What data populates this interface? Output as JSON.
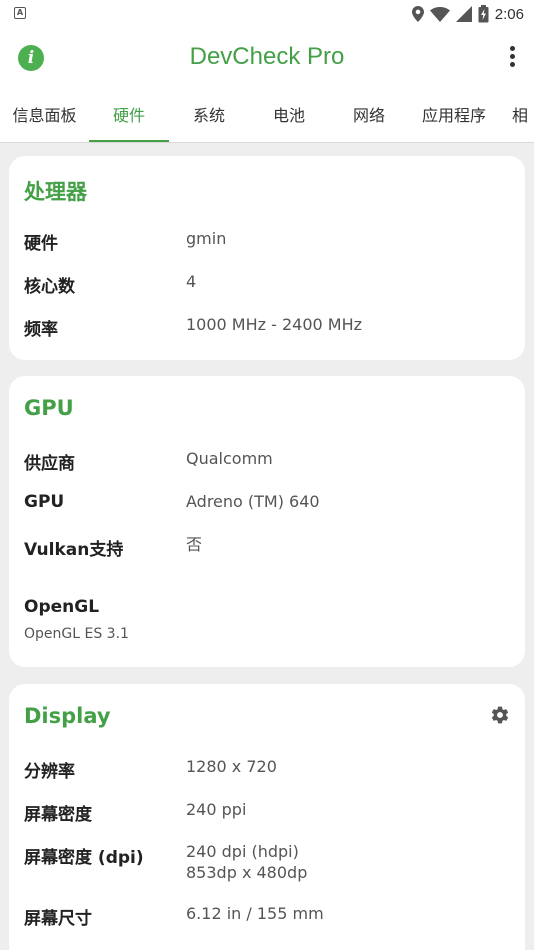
{
  "status_bar": {
    "time": "2:06",
    "notification_icon": "A"
  },
  "app": {
    "title": "DevCheck Pro"
  },
  "tabs": [
    "信息面板",
    "硬件",
    "系统",
    "电池",
    "网络",
    "应用程序",
    "相"
  ],
  "active_tab": "硬件",
  "processor": {
    "title": "处理器",
    "rows": [
      {
        "label": "硬件",
        "value": "gmin"
      },
      {
        "label": "核心数",
        "value": "4"
      },
      {
        "label": "频率",
        "value": "1000 MHz - 2400 MHz"
      }
    ]
  },
  "gpu": {
    "title": "GPU",
    "rows": [
      {
        "label": "供应商",
        "value": "Qualcomm"
      },
      {
        "label": "GPU",
        "value": "Adreno (TM) 640"
      },
      {
        "label": "Vulkan支持",
        "value": "否"
      }
    ],
    "opengl_label": "OpenGL",
    "opengl_value": "OpenGL ES 3.1"
  },
  "display": {
    "title": "Display",
    "rows": [
      {
        "label": "分辨率",
        "value": "1280 x 720"
      },
      {
        "label": "屏幕密度",
        "value": "240 ppi"
      },
      {
        "label": "屏幕密度 (dpi)",
        "value": "240 dpi (hdpi)",
        "value2": "853dp x 480dp"
      },
      {
        "label": "屏幕尺寸",
        "value": "6.12 in / 155 mm"
      }
    ]
  },
  "colors": {
    "accent": "#43a047",
    "background": "#eeeeee",
    "card": "#ffffff"
  }
}
